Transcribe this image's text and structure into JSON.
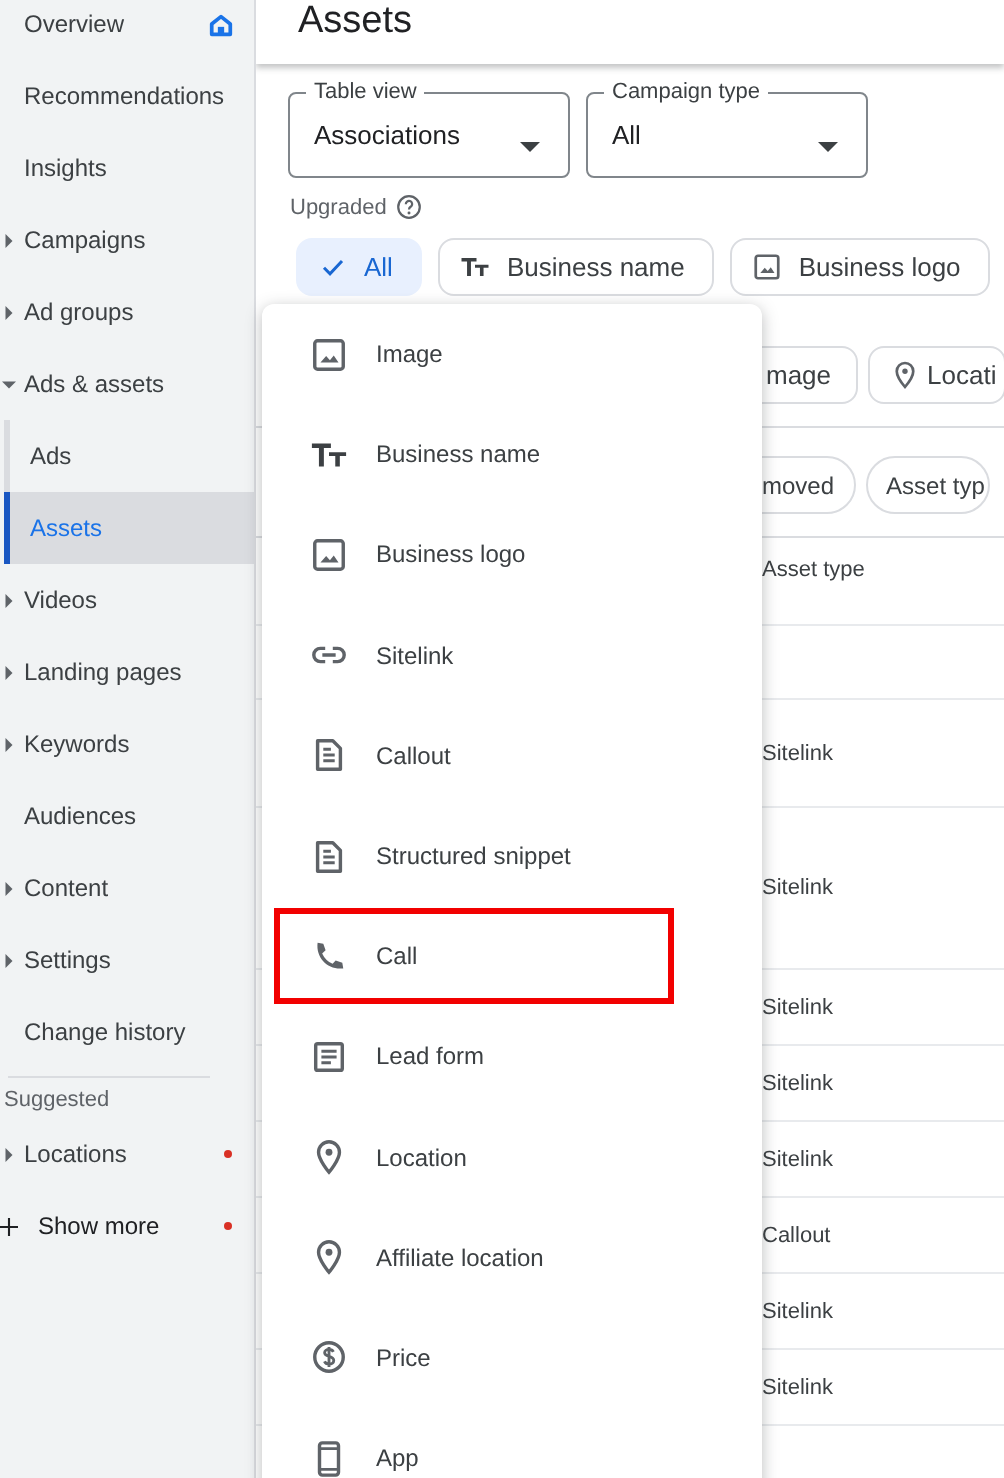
{
  "sidebar": {
    "items": [
      {
        "label": "Overview",
        "kind": "home",
        "expandable": false,
        "expanded": false,
        "selected": false
      },
      {
        "label": "Recommendations",
        "kind": "page",
        "expandable": false,
        "expanded": false,
        "selected": false
      },
      {
        "label": "Insights",
        "kind": "page",
        "expandable": false,
        "expanded": false,
        "selected": false
      },
      {
        "label": "Campaigns",
        "kind": "page",
        "expandable": true,
        "expanded": false,
        "selected": false
      },
      {
        "label": "Ad groups",
        "kind": "page",
        "expandable": true,
        "expanded": false,
        "selected": false
      },
      {
        "label": "Ads & assets",
        "kind": "page",
        "expandable": true,
        "expanded": true,
        "selected": false,
        "children": [
          {
            "label": "Ads",
            "selected": false
          },
          {
            "label": "Assets",
            "selected": true
          }
        ]
      },
      {
        "label": "Videos",
        "kind": "page",
        "expandable": true,
        "expanded": false,
        "selected": false
      },
      {
        "label": "Landing pages",
        "kind": "page",
        "expandable": true,
        "expanded": false,
        "selected": false
      },
      {
        "label": "Keywords",
        "kind": "page",
        "expandable": true,
        "expanded": false,
        "selected": false
      },
      {
        "label": "Audiences",
        "kind": "page",
        "expandable": false,
        "expanded": false,
        "selected": false
      },
      {
        "label": "Content",
        "kind": "page",
        "expandable": true,
        "expanded": false,
        "selected": false
      },
      {
        "label": "Settings",
        "kind": "page",
        "expandable": true,
        "expanded": false,
        "selected": false
      },
      {
        "label": "Change history",
        "kind": "page",
        "expandable": false,
        "expanded": false,
        "selected": false
      }
    ],
    "suggested": {
      "label": "Suggested",
      "items": [
        {
          "label": "Locations",
          "kind": "page",
          "expandable": true,
          "expanded": false,
          "notification": true
        },
        {
          "label": "Show more",
          "kind": "add",
          "expandable": false,
          "expanded": false,
          "notification": true
        }
      ]
    }
  },
  "page_title": "Assets",
  "fields": [
    {
      "label": "Table view",
      "value": "Associations"
    },
    {
      "label": "Campaign type",
      "value": "All"
    }
  ],
  "upgraded": {
    "label": "Upgraded"
  },
  "chips": [
    {
      "label": "All",
      "kind": "check",
      "selected": true
    },
    {
      "label": "Business name",
      "kind": "text",
      "selected": false
    },
    {
      "label": "Business logo",
      "kind": "image",
      "selected": false
    }
  ],
  "chips_row_2": [
    {
      "label": "mage",
      "kind": "plain"
    },
    {
      "label": "Locati",
      "kind": "pin"
    }
  ],
  "chips_row_3": [
    {
      "label": "moved"
    },
    {
      "label": "Asset typ"
    }
  ],
  "table": {
    "columns": [
      "Asset type"
    ],
    "rows": [
      {
        "asset_type": "Sitelink"
      },
      {
        "asset_type": "Sitelink"
      },
      {
        "asset_type": "Sitelink"
      },
      {
        "asset_type": "Sitelink"
      },
      {
        "asset_type": "Sitelink"
      },
      {
        "asset_type": "Callout"
      },
      {
        "asset_type": "Sitelink"
      },
      {
        "asset_type": "Sitelink"
      }
    ]
  },
  "menu": {
    "items": [
      {
        "label": "Image",
        "kind": "image",
        "highlighted": false
      },
      {
        "label": "Business name",
        "kind": "text",
        "highlighted": false
      },
      {
        "label": "Business logo",
        "kind": "image",
        "highlighted": false
      },
      {
        "label": "Sitelink",
        "kind": "link",
        "highlighted": false
      },
      {
        "label": "Callout",
        "kind": "doc",
        "highlighted": false
      },
      {
        "label": "Structured snippet",
        "kind": "doc",
        "highlighted": false
      },
      {
        "label": "Call",
        "kind": "phone",
        "highlighted": true
      },
      {
        "label": "Lead form",
        "kind": "form",
        "highlighted": false
      },
      {
        "label": "Location",
        "kind": "pin",
        "highlighted": false
      },
      {
        "label": "Affiliate location",
        "kind": "pin",
        "highlighted": false
      },
      {
        "label": "Price",
        "kind": "price",
        "highlighted": false
      },
      {
        "label": "App",
        "kind": "app",
        "highlighted": false
      }
    ]
  }
}
